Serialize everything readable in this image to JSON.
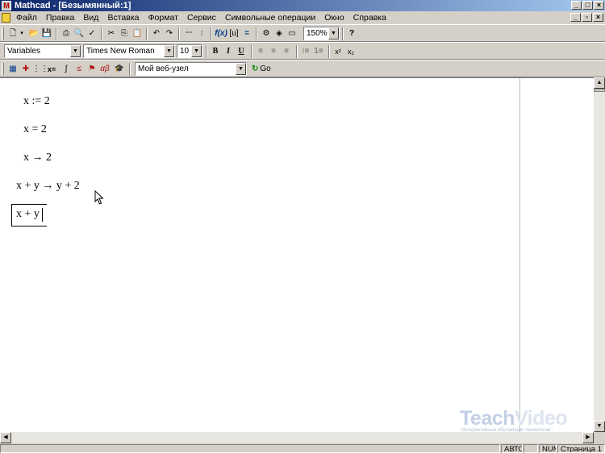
{
  "window": {
    "title": "Mathcad - [Безымянный:1]"
  },
  "menu": {
    "items": [
      "Файл",
      "Правка",
      "Вид",
      "Вставка",
      "Формат",
      "Сервис",
      "Символьные операции",
      "Окно",
      "Справка"
    ]
  },
  "toolbar": {
    "zoom": "150%",
    "style": "Variables",
    "font": "Times New Roman",
    "size": "10",
    "bold": "B",
    "italic": "I",
    "underline": "U",
    "superscript": "x²",
    "subscript": "x₂",
    "calc_equal": "x=",
    "address": "Мой веб-узел",
    "go": "Go"
  },
  "document": {
    "expressions": [
      "x := 2",
      "x = 2",
      "x → 2",
      "x + y → y + 2"
    ],
    "editing": "x + y"
  },
  "watermark": {
    "brand_a": "Teach",
    "brand_b": "Video",
    "tagline": "Интерактивные обучающие технологии"
  },
  "status": {
    "mode": "АВТО",
    "num": "NUM",
    "page": "Страница 1"
  }
}
